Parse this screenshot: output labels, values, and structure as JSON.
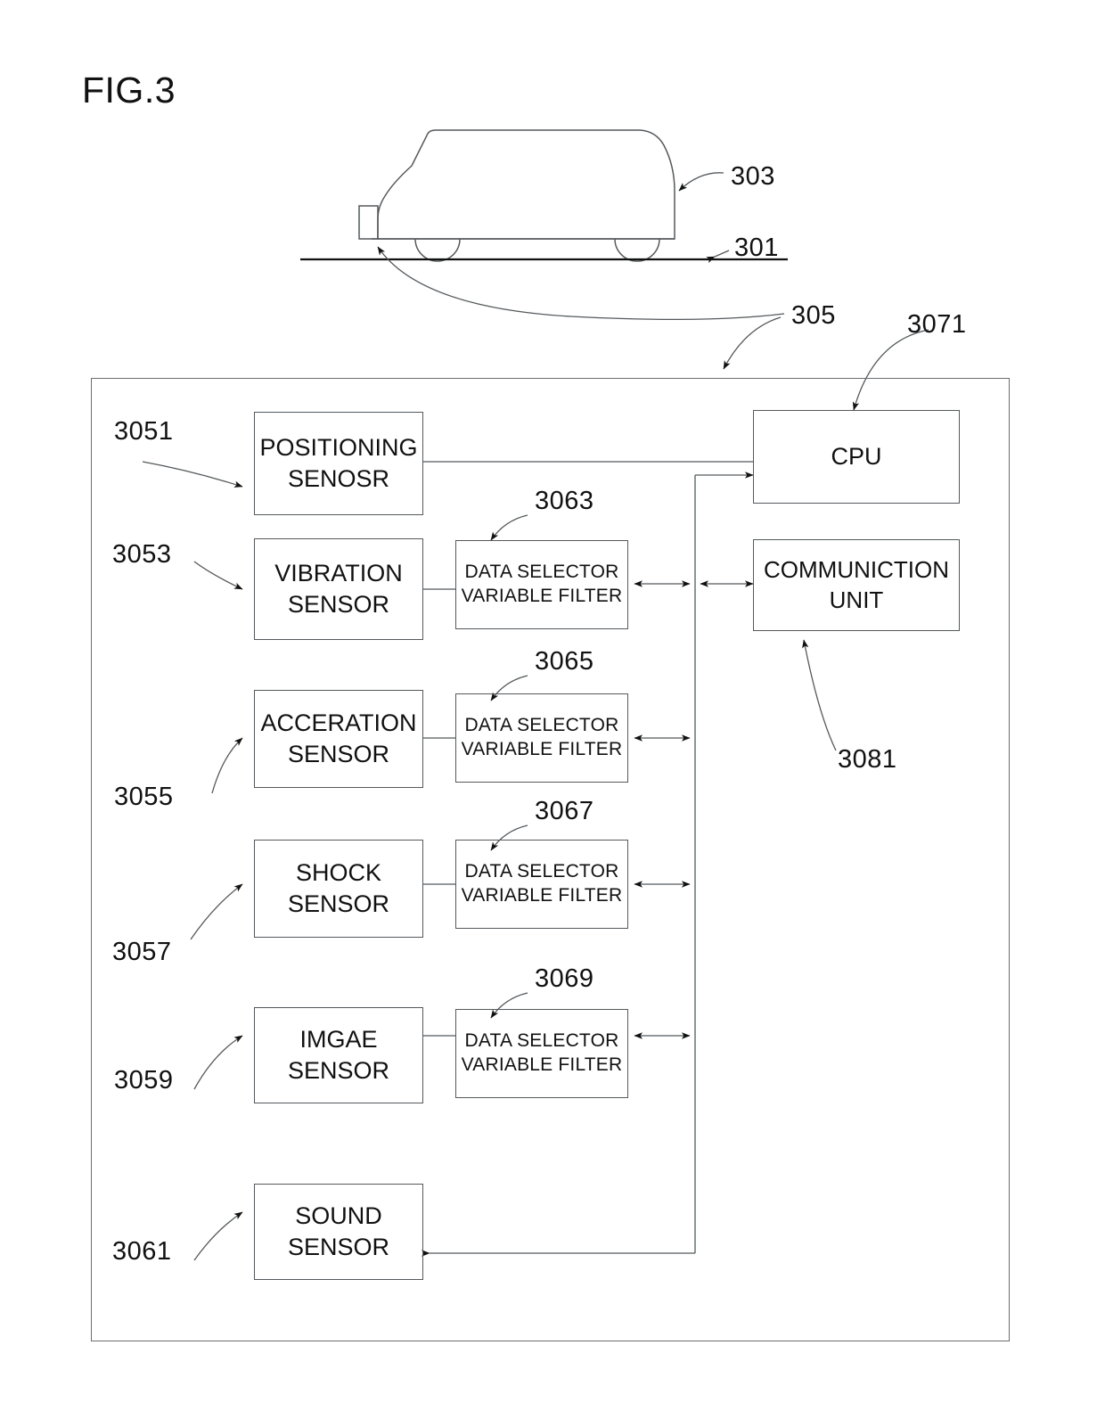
{
  "figure": {
    "title": "FIG.3"
  },
  "vehicle": {
    "body_ref": "303",
    "ground_ref": "301",
    "system_ref": "305"
  },
  "container": {
    "ref": "305"
  },
  "sensors": [
    {
      "ref": "3051",
      "line1": "POSITIONING",
      "line2": "SENOSR"
    },
    {
      "ref": "3053",
      "line1": "VIBRATION",
      "line2": "SENSOR"
    },
    {
      "ref": "3055",
      "line1": "ACCERATION",
      "line2": "SENSOR"
    },
    {
      "ref": "3057",
      "line1": "SHOCK",
      "line2": "SENSOR"
    },
    {
      "ref": "3059",
      "line1": "IMGAE",
      "line2": "SENSOR"
    },
    {
      "ref": "3061",
      "line1": "SOUND",
      "line2": "SENSOR"
    }
  ],
  "filters": [
    {
      "ref": "3063",
      "line1": "DATA SELECTOR",
      "line2": "VARIABLE FILTER"
    },
    {
      "ref": "3065",
      "line1": "DATA SELECTOR",
      "line2": "VARIABLE FILTER"
    },
    {
      "ref": "3067",
      "line1": "DATA SELECTOR",
      "line2": "VARIABLE FILTER"
    },
    {
      "ref": "3069",
      "line1": "DATA SELECTOR",
      "line2": "VARIABLE FILTER"
    }
  ],
  "processing": {
    "cpu": {
      "ref": "3071",
      "line1": "CPU",
      "line2": ""
    },
    "comm": {
      "ref": "3081",
      "line1": "COMMUNICTION",
      "line2": "UNIT"
    }
  },
  "colors": {
    "ink": "#111111",
    "line": "#55595c",
    "background": "#ffffff"
  }
}
